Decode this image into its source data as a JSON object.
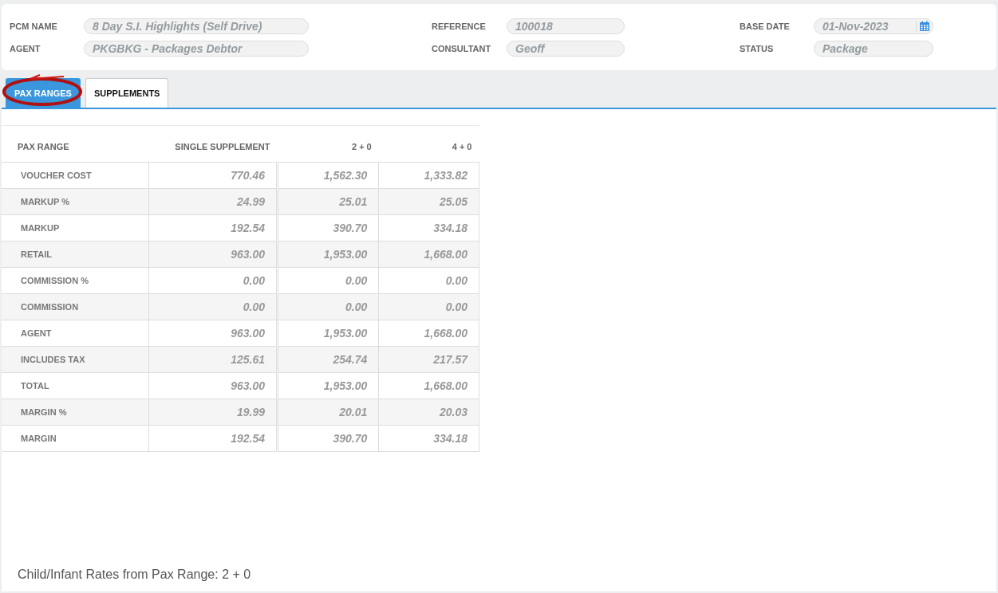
{
  "header": {
    "fields": [
      {
        "label": "PCM NAME",
        "value": "8 Day S.I. Highlights (Self Drive)",
        "kind": "text"
      },
      {
        "label": "REFERENCE",
        "value": "100018",
        "kind": "text"
      },
      {
        "label": "BASE DATE",
        "value": "01-Nov-2023",
        "kind": "date"
      },
      {
        "label": "AGENT",
        "value": "PKGBKG - Packages Debtor",
        "kind": "text"
      },
      {
        "label": "CONSULTANT",
        "value": "Geoff",
        "kind": "text"
      },
      {
        "label": "STATUS",
        "value": "Package",
        "kind": "text"
      }
    ]
  },
  "tabs": [
    {
      "label": "PAX RANGES",
      "selected": true
    },
    {
      "label": "SUPPLEMENTS",
      "selected": false
    }
  ],
  "table": {
    "columns": [
      "PAX RANGE",
      "SINGLE SUPPLEMENT",
      "2 + 0",
      "4 + 0"
    ],
    "rows": [
      {
        "label": "VOUCHER COST",
        "values": [
          "770.46",
          "1,562.30",
          "1,333.82"
        ]
      },
      {
        "label": "MARKUP %",
        "values": [
          "24.99",
          "25.01",
          "25.05"
        ]
      },
      {
        "label": "MARKUP",
        "values": [
          "192.54",
          "390.70",
          "334.18"
        ]
      },
      {
        "label": "RETAIL",
        "values": [
          "963.00",
          "1,953.00",
          "1,668.00"
        ]
      },
      {
        "label": "COMMISSION %",
        "values": [
          "0.00",
          "0.00",
          "0.00"
        ]
      },
      {
        "label": "COMMISSION",
        "values": [
          "0.00",
          "0.00",
          "0.00"
        ]
      },
      {
        "label": "AGENT",
        "values": [
          "963.00",
          "1,953.00",
          "1,668.00"
        ]
      },
      {
        "label": "INCLUDES TAX",
        "values": [
          "125.61",
          "254.74",
          "217.57"
        ]
      },
      {
        "label": "TOTAL",
        "values": [
          "963.00",
          "1,953.00",
          "1,668.00"
        ]
      },
      {
        "label": "MARGIN %",
        "values": [
          "19.99",
          "20.01",
          "20.03"
        ]
      },
      {
        "label": "MARGIN",
        "values": [
          "192.54",
          "390.70",
          "334.18"
        ]
      }
    ]
  },
  "footer_note": "Child/Infant Rates from Pax Range: 2 + 0"
}
